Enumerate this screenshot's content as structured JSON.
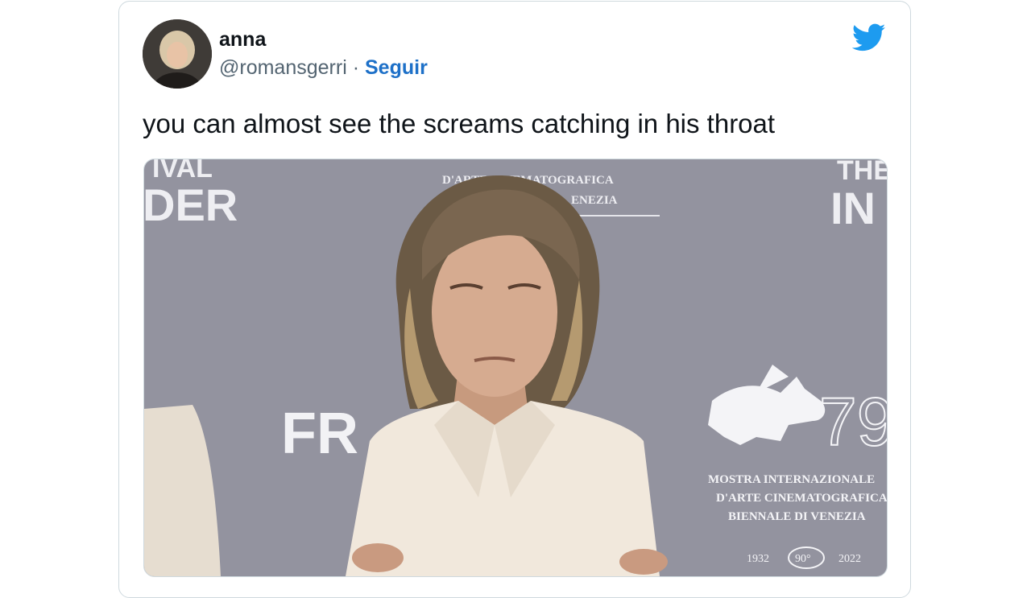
{
  "tweet": {
    "author_name": "anna",
    "handle": "@romansgerri",
    "separator": "·",
    "follow_label": "Seguir",
    "text": "you can almost see the screams catching in his throat"
  },
  "media": {
    "backdrop_text_left_top": "IVAL",
    "backdrop_text_left_mid": "DER",
    "backdrop_text_top_center_1": "D'ARTE CINEMATOGRAFICA",
    "backdrop_text_top_center_2": "ENEZIA",
    "backdrop_text_right_top": "THE",
    "backdrop_text_right_mid": "IN",
    "backdrop_text_fr": "FR",
    "festival_number": "79",
    "festival_line_1": "MOSTRA INTERNAZIONALE",
    "festival_line_2": "D'ARTE CINEMATOGRAFICA",
    "festival_line_3": "BIENNALE DI VENEZIA",
    "badge_left": "1932",
    "badge_center": "90°",
    "badge_right": "2022"
  },
  "colors": {
    "link_blue": "#1d70c8",
    "twitter_blue": "#1d9bf0",
    "backdrop_gray": "#8f909c"
  },
  "icons": {
    "brand": "twitter-bird-icon"
  }
}
